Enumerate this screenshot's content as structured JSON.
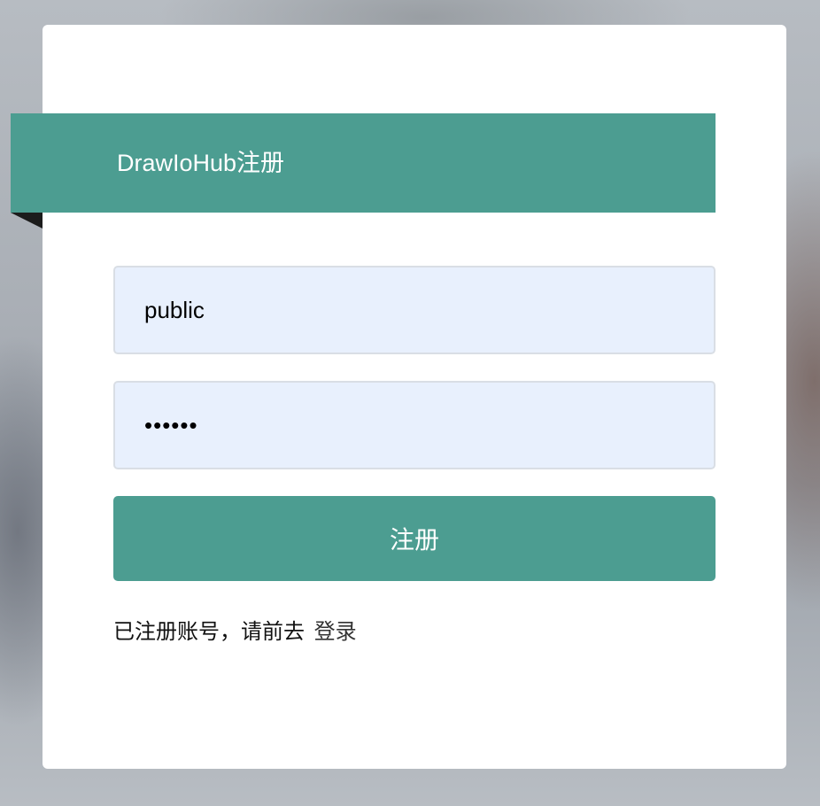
{
  "header": {
    "title": "DrawIoHub注册"
  },
  "form": {
    "username_value": "public",
    "password_value": "aaaaaa",
    "submit_label": "注册"
  },
  "footer": {
    "prompt_text": "已注册账号，请前去",
    "login_link_label": "登录"
  },
  "colors": {
    "accent": "#4c9d91",
    "input_background": "#e8f0fd",
    "card_background": "#ffffff"
  }
}
